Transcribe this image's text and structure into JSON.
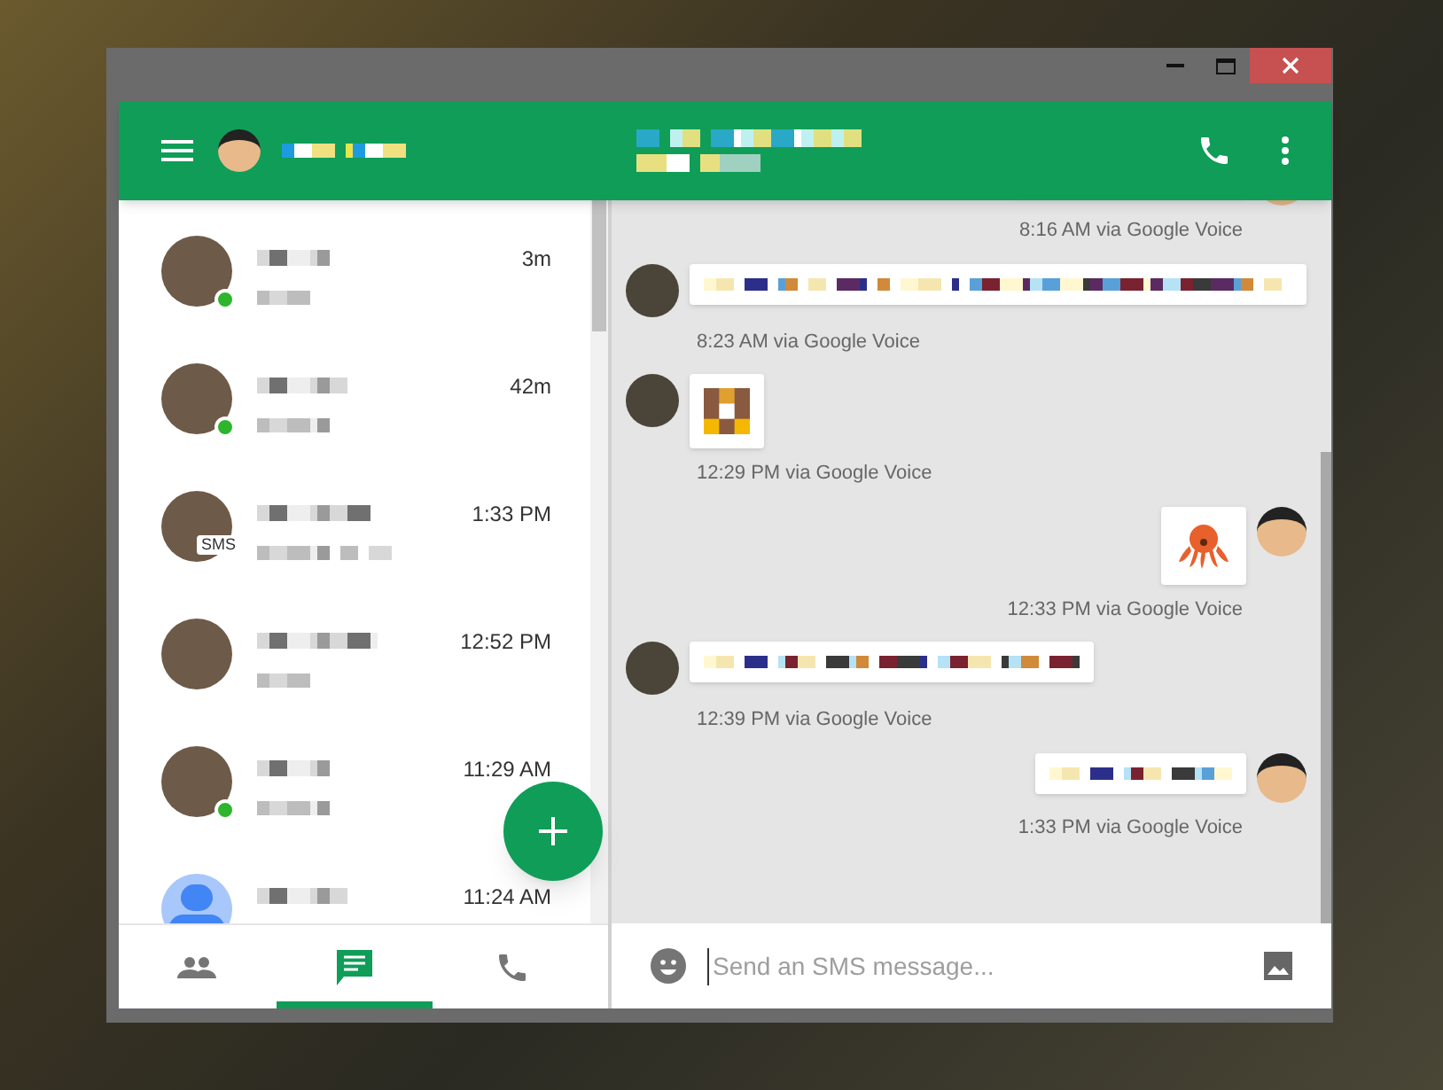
{
  "conversations": [
    {
      "time": "3m",
      "online": true,
      "kind": "photo"
    },
    {
      "time": "42m",
      "online": true,
      "kind": "photo"
    },
    {
      "time": "1:33 PM",
      "online": false,
      "badge": "SMS",
      "kind": "photo"
    },
    {
      "time": "12:52 PM",
      "online": false,
      "kind": "photo"
    },
    {
      "time": "11:29 AM",
      "online": true,
      "kind": "photo"
    },
    {
      "time": "11:24 AM",
      "online": false,
      "kind": "default"
    }
  ],
  "nav_tabs": [
    {
      "kind": "people",
      "selected": false
    },
    {
      "kind": "chat",
      "selected": true
    },
    {
      "kind": "phone",
      "selected": false
    }
  ],
  "messages": [
    {
      "outgoing": true,
      "kind": "pixelated",
      "meta": "8:16 AM via Google Voice"
    },
    {
      "outgoing": false,
      "kind": "pixelated",
      "meta": "8:23 AM via Google Voice"
    },
    {
      "outgoing": false,
      "kind": "pixelated-sticker",
      "meta": "12:29 PM via Google Voice"
    },
    {
      "outgoing": true,
      "kind": "sticker",
      "meta": "12:33 PM via Google Voice"
    },
    {
      "outgoing": false,
      "kind": "pixelated",
      "meta": "12:39 PM via Google Voice"
    },
    {
      "outgoing": true,
      "kind": "pixelated",
      "meta": "1:33 PM via Google Voice"
    }
  ],
  "composer": {
    "placeholder": "Send an SMS message..."
  }
}
